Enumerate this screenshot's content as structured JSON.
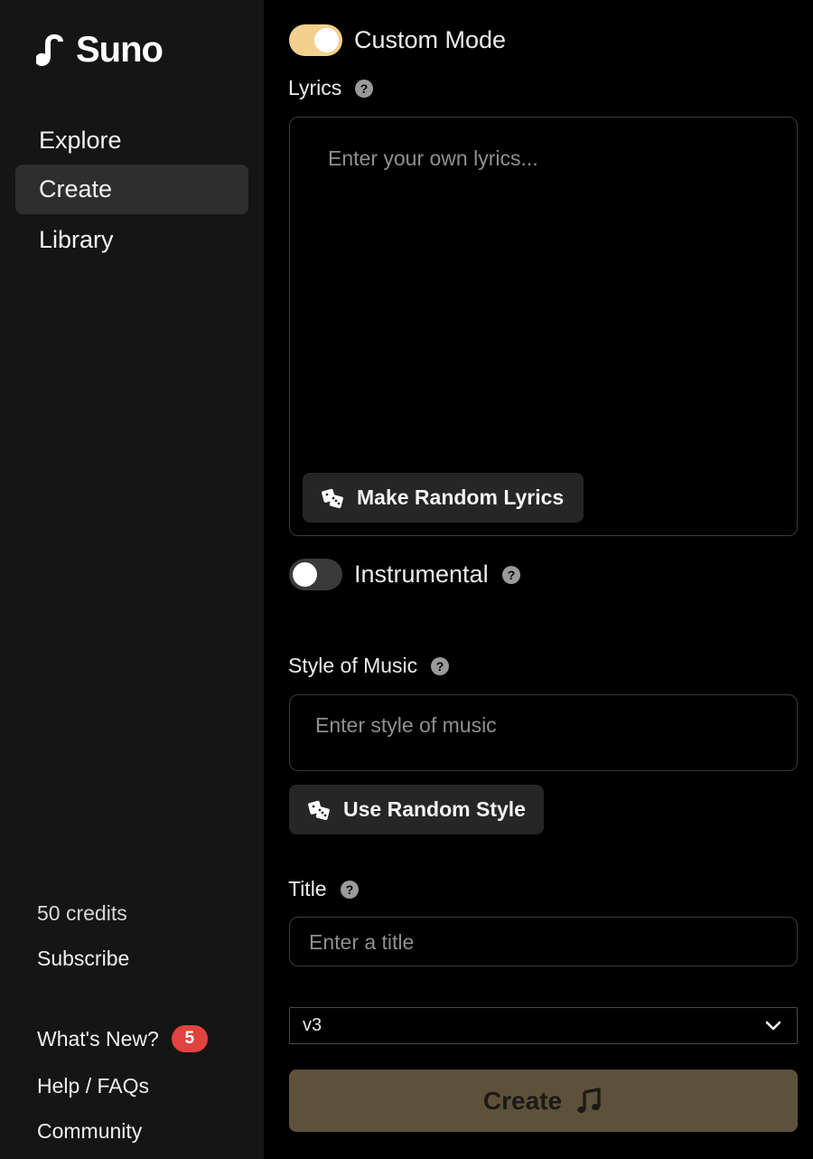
{
  "app": {
    "name": "Suno"
  },
  "sidebar": {
    "nav": [
      {
        "label": "Explore",
        "active": false
      },
      {
        "label": "Create",
        "active": true
      },
      {
        "label": "Library",
        "active": false
      }
    ],
    "credits": "50 credits",
    "subscribe": "Subscribe",
    "whats_new": {
      "label": "What's New?",
      "count": "5"
    },
    "help": "Help / FAQs",
    "community": "Community"
  },
  "form": {
    "custom_mode": {
      "label": "Custom Mode",
      "on": true
    },
    "lyrics": {
      "label": "Lyrics",
      "placeholder": "Enter your own lyrics...",
      "random_button": "Make Random Lyrics"
    },
    "instrumental": {
      "label": "Instrumental",
      "on": false
    },
    "style": {
      "label": "Style of Music",
      "placeholder": "Enter style of music",
      "random_button": "Use Random Style"
    },
    "title": {
      "label": "Title",
      "placeholder": "Enter a title"
    },
    "model": {
      "selected": "v3"
    },
    "submit": "Create"
  },
  "colors": {
    "toggle_on": "#f4d08e",
    "create_button": "#5d5139",
    "badge": "#e0443e"
  }
}
